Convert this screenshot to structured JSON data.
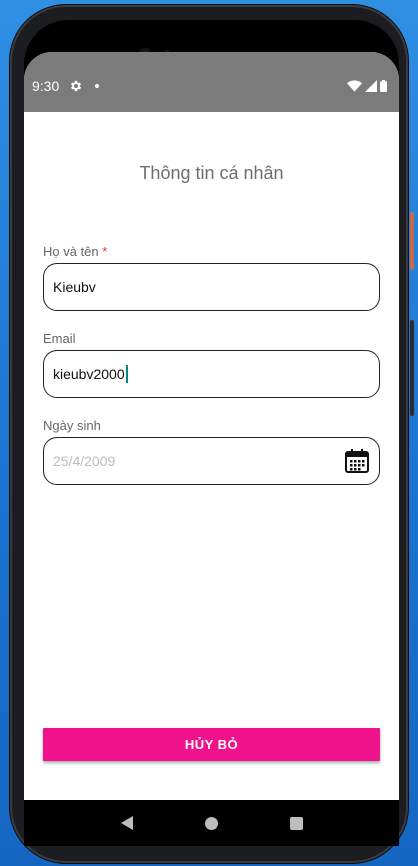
{
  "status_bar": {
    "time": "9:30",
    "icons": [
      "gear-icon",
      "notification-dot-icon",
      "wifi-icon",
      "signal-icon",
      "battery-icon"
    ]
  },
  "form": {
    "title": "Thông tin cá nhân",
    "full_name": {
      "label": "Họ và tên",
      "required_mark": "*",
      "value": "Kieubv"
    },
    "email": {
      "label": "Email",
      "value": "kieubv2000"
    },
    "birth_date": {
      "label": "Ngày sinh",
      "placeholder": "25/4/2009",
      "icon": "calendar-icon"
    }
  },
  "actions": {
    "cancel_label": "HỦY BỎ"
  },
  "colors": {
    "accent": "#f0128a",
    "status_bar": "#7b7b7b",
    "required": "#e53935",
    "caret": "#00897b"
  },
  "nav_bar": {
    "icons": [
      "back-icon",
      "home-icon",
      "recents-icon"
    ]
  }
}
